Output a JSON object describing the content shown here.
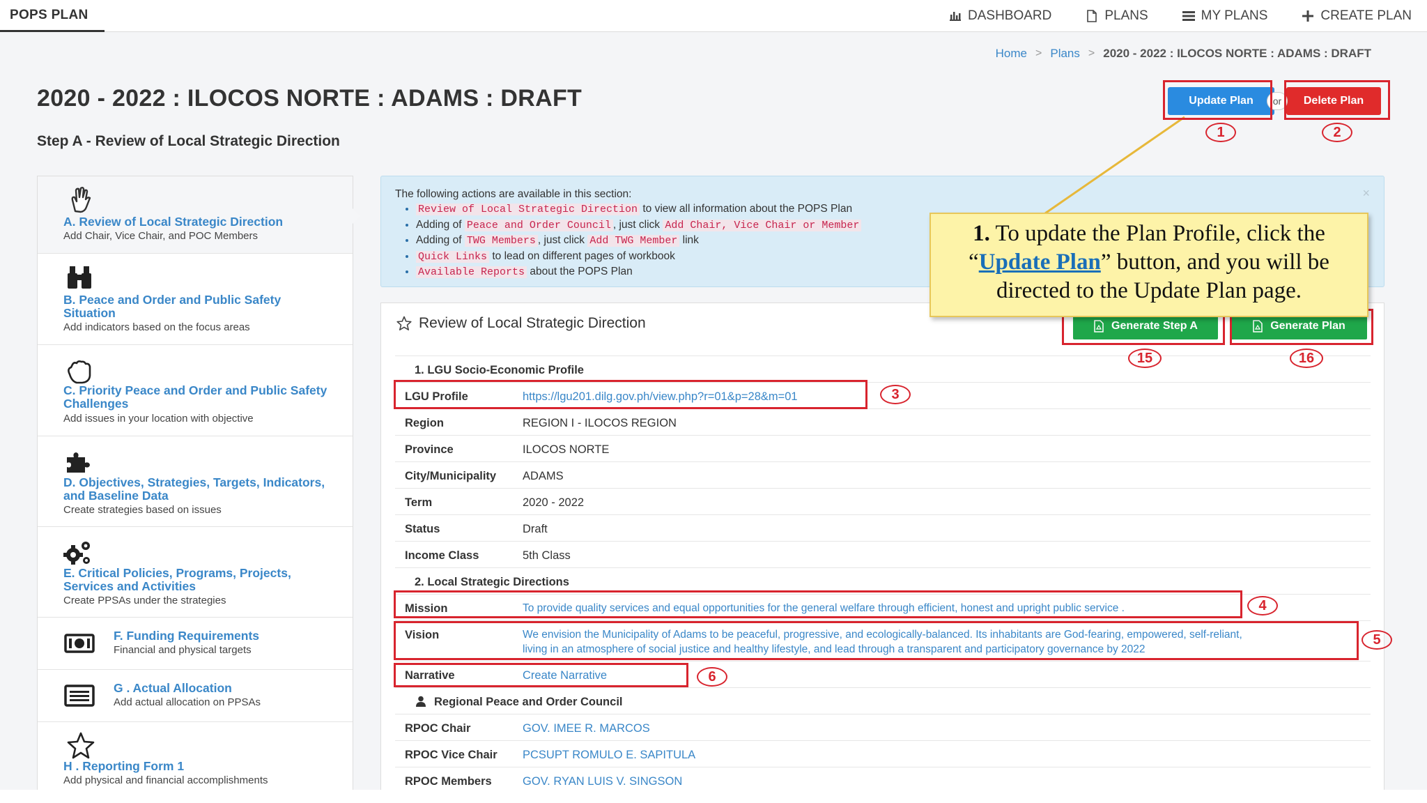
{
  "topbar": {
    "brand": "POPS PLAN",
    "nav": [
      {
        "label": "DASHBOARD",
        "icon": "bar-chart-icon"
      },
      {
        "label": "PLANS",
        "icon": "document-icon"
      },
      {
        "label": "MY PLANS",
        "icon": "list-icon"
      },
      {
        "label": "CREATE PLAN",
        "icon": "plus-icon"
      }
    ]
  },
  "breadcrumb": {
    "home": "Home",
    "plans": "Plans",
    "current": "2020 - 2022 : ILOCOS NORTE : ADAMS : DRAFT",
    "separator": ">"
  },
  "header": {
    "title": "2020 - 2022 : ILOCOS NORTE : ADAMS : DRAFT",
    "step": "Step A - Review of Local Strategic Direction",
    "update_label": "Update Plan",
    "or_label": "or",
    "delete_label": "Delete Plan"
  },
  "markers": {
    "m1": "1",
    "m2": "2",
    "m3": "3",
    "m4": "4",
    "m5": "5",
    "m6": "6",
    "m15": "15",
    "m16": "16"
  },
  "sidebar": {
    "items": [
      {
        "title": "A. Review of Local Strategic Direction",
        "subtitle": "Add Chair, Vice Chair, and POC Members",
        "icon": "hand-icon"
      },
      {
        "title": "B. Peace and Order and Public Safety Situation",
        "subtitle": "Add indicators based on the focus areas",
        "icon": "binoculars-icon"
      },
      {
        "title": "C. Priority Peace and Order and Public Safety Challenges",
        "subtitle": "Add issues in your location with objective",
        "icon": "hand-paper-icon"
      },
      {
        "title": "D. Objectives, Strategies, Targets, Indicators, and Baseline Data",
        "subtitle": "Create strategies based on issues",
        "icon": "puzzle-icon"
      },
      {
        "title": "E. Critical Policies, Programs, Projects, Services and Activities",
        "subtitle": "Create PPSAs under the strategies",
        "icon": "gears-icon"
      },
      {
        "title": "F. Funding Requirements",
        "subtitle": "Financial and physical targets",
        "icon": "money-icon"
      },
      {
        "title": "G . Actual Allocation",
        "subtitle": "Add actual allocation on PPSAs",
        "icon": "list-alt-icon"
      },
      {
        "title": "H . Reporting Form 1",
        "subtitle": "Add physical and financial accomplishments",
        "icon": "star-icon"
      }
    ]
  },
  "info": {
    "intro": "The following actions are available in this section:",
    "items": [
      {
        "code": "Review of Local Strategic Direction",
        "text": " to view all information about the POPS Plan"
      },
      {
        "pre": "Adding of ",
        "code": "Peace and Order Council",
        "mid": ", just click ",
        "code2": "Add Chair, Vice Chair or Member"
      },
      {
        "pre": "Adding of ",
        "code": "TWG Members",
        "mid": ", just click ",
        "code2": "Add TWG Member",
        "post": " link"
      },
      {
        "code": "Quick Links",
        "text": " to lead on different pages of workbook"
      },
      {
        "code": "Available Reports",
        "text": " about the POPS Plan"
      }
    ],
    "close": "×"
  },
  "card": {
    "title": "Review of Local Strategic Direction",
    "btn_step": "Generate Step A",
    "btn_plan": "Generate Plan",
    "section1": "1. LGU Socio-Economic Profile",
    "section2": "2. Local Strategic Directions",
    "section3": "Regional Peace and Order Council",
    "rows": {
      "lgu_profile": {
        "k": "LGU Profile",
        "v": "https://lgu201.dilg.gov.ph/view.php?r=01&p=28&m=01"
      },
      "region": {
        "k": "Region",
        "v": "REGION I - ILOCOS REGION"
      },
      "province": {
        "k": "Province",
        "v": "ILOCOS NORTE"
      },
      "city": {
        "k": "City/Municipality",
        "v": "ADAMS"
      },
      "term": {
        "k": "Term",
        "v": "2020 - 2022"
      },
      "status": {
        "k": "Status",
        "v": "Draft"
      },
      "income": {
        "k": "Income Class",
        "v": "5th Class"
      },
      "mission": {
        "k": "Mission",
        "v": "To provide quality services and equal opportunities for the general welfare through efficient, honest and upright public service ."
      },
      "vision": {
        "k": "Vision",
        "v1": "We envision the Municipality of Adams to be peaceful, progressive, and ecologically-balanced. Its inhabitants are God-fearing, empowered, self-reliant,",
        "v2": "living in an atmosphere of social justice and healthy lifestyle, and lead through a transparent and participatory governance by 2022"
      },
      "narrative": {
        "k": "Narrative",
        "v": "Create Narrative"
      },
      "rpoc_chair": {
        "k": "RPOC Chair",
        "v": "GOV. IMEE R. MARCOS"
      },
      "rpoc_vice": {
        "k": "RPOC Vice Chair",
        "v": "PCSUPT ROMULO E. SAPITULA"
      },
      "rpoc_members": {
        "k": "RPOC Members",
        "v": "GOV. RYAN LUIS V. SINGSON"
      }
    }
  },
  "callout": {
    "num": "1.",
    "pre": " To update the Plan Profile, click the “",
    "link": "Update Plan",
    "post": "” button, and you will be directed to the Update Plan page."
  },
  "colors": {
    "primary": "#2a8be0",
    "danger": "#e02b2b",
    "success": "#1fa74a",
    "annotation": "#d8242e",
    "link": "#3a87c8",
    "callout_bg": "#fdf3a8"
  }
}
